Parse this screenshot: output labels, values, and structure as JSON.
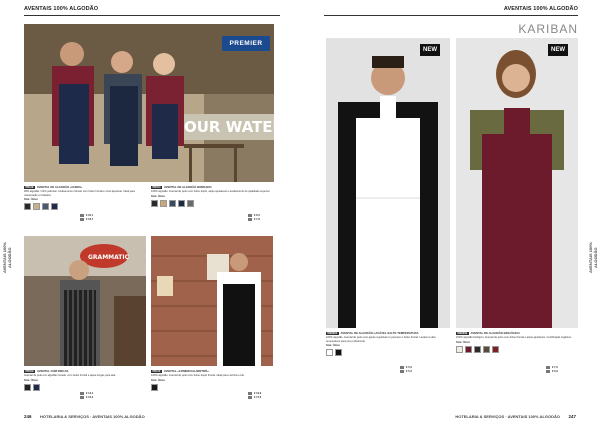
{
  "left": {
    "header": "AVENTAIS 100% ALGODÃO",
    "side_tab": "AVENTAIS 100% ALGODÃO",
    "brand": "PREMIER",
    "products": [
      {
        "code": "PR119",
        "title": "AVENTAL DE ALGODÃO «CHINO»",
        "desc": "90% algodão / 10% poliéster. Acabamento robusto com bolso frontal e cinto ajustável. Ideal para restauração e hotelaria.",
        "label": "Size: Único",
        "prices": [
          "€ 20,1",
          "€ 18,7"
        ],
        "swatch_colors": [
          "#2a2a2a",
          "#c9b08a",
          "#4a5a6a",
          "#1f2b4a"
        ]
      },
      {
        "code": "PR154",
        "title": "AVENTAL DE ALGODÃO BORDADO",
        "desc": "100% algodão. Avental de peito com bolso duplo, alças ajustáveis e acabamento de qualidade superior.",
        "label": "Size: Único",
        "prices": [
          "€ 8,3",
          "€ 7,8"
        ],
        "swatch_colors": [
          "#2a2a2a",
          "#c8a878",
          "#3a4a5e",
          "#1c2a44",
          "#6a6a6a"
        ]
      },
      {
        "code": "PR109",
        "title": "AVENTAL COM RISCAS",
        "desc": "Avental de peito em algodão riscado, com bolso frontal e alças longas para atar.",
        "label": "Size: Único",
        "prices": [
          "€ 13,4",
          "€ 12,2"
        ],
        "swatch_colors": [
          "#222",
          "#1e2a4a"
        ]
      },
      {
        "code": "PR110",
        "title": "AVENTAL «COMERCIAL/BISTRÔ»",
        "desc": "100% algodão. Avental de peito com bolso duplo frontal, ideal para cozinha e bar.",
        "label": "Size: Único",
        "prices": [
          "€ 19,9",
          "€ 17,6"
        ],
        "swatch_colors": [
          "#1a1a1a"
        ]
      }
    ],
    "footer": "HOTELARIA & SERVIÇOS · AVENTAIS 100% ALGODÃO",
    "page_number": "246"
  },
  "right": {
    "header": "AVENTAIS 100% ALGODÃO",
    "side_tab": "AVENTAIS 100% ALGODÃO",
    "brand": "KARIBAN",
    "new_label": "NEW",
    "products": [
      {
        "code": "KB8003",
        "title": "AVENTAL DE ALGODÃO LAVÁVEL SALTO TEMPERATURA",
        "desc": "100% algodão. Avental de peito com ajuste regulável no pescoço e bolso frontal. Lavável a alta temperatura para uso profissional.",
        "label": "Size: Único",
        "prices": [
          "€ 5,9",
          "€ 5,3"
        ],
        "swatch_colors": [
          "#ffffff",
          "#111111"
        ]
      },
      {
        "code": "KB8009",
        "title": "AVENTAL DE ALGODÃO BIOLÓGICO",
        "desc": "100% algodão biológico. Avental de peito com bolso frontal e alças ajustáveis. Certificação orgânica.",
        "label": "Size: Único",
        "prices": [
          "€ 7,6",
          "€ 6,9"
        ],
        "swatch_colors": [
          "#f2ede3",
          "#6b1b2b",
          "#2b2b2b",
          "#5a4a3a",
          "#7a2020"
        ]
      }
    ],
    "footer": "HOTELARIA & SERVIÇOS · AVENTAIS 100% ALGODÃO",
    "page_number": "247"
  }
}
